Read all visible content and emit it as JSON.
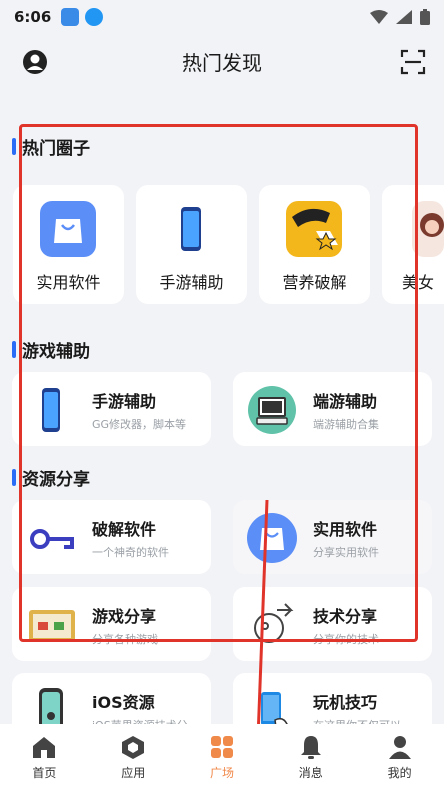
{
  "status_bar": {
    "time": "6:06"
  },
  "header": {
    "title": "热门发现"
  },
  "sections": {
    "hot_circles": {
      "title": "热门圈子"
    },
    "game_assist": {
      "title": "游戏辅助"
    },
    "resource_share": {
      "title": "资源分享"
    }
  },
  "hot_circles": [
    {
      "label": "实用软件",
      "icon": "bag-icon"
    },
    {
      "label": "手游辅助",
      "icon": "phone-icon"
    },
    {
      "label": "营养破解",
      "icon": "crack-icon"
    },
    {
      "label": "美女",
      "icon": "avatar-icon"
    }
  ],
  "game_assist": [
    {
      "title": "手游辅助",
      "subtitle": "GG修改器，脚本等",
      "icon": "phone-icon"
    },
    {
      "title": "端游辅助",
      "subtitle": "端游辅助合集",
      "icon": "pc-icon"
    }
  ],
  "resource_share": [
    {
      "title": "破解软件",
      "subtitle": "一个神奇的软件",
      "icon": "key-icon"
    },
    {
      "title": "实用软件",
      "subtitle": "分享实用软件",
      "icon": "bag-icon"
    },
    {
      "title": "游戏分享",
      "subtitle": "分享各种游戏",
      "icon": "game-icon"
    },
    {
      "title": "技术分享",
      "subtitle": "分享你的技术",
      "icon": "tech-icon"
    },
    {
      "title": "iOS资源",
      "subtitle": "iOS苹果资源技术分",
      "icon": "iphone-icon"
    },
    {
      "title": "玩机技巧",
      "subtitle": "在这里你不仅可以",
      "icon": "hand-phone-icon"
    }
  ],
  "tabs": [
    {
      "label": "首页",
      "icon": "home-icon"
    },
    {
      "label": "应用",
      "icon": "cube-icon"
    },
    {
      "label": "广场",
      "icon": "grid-icon",
      "active": true
    },
    {
      "label": "消息",
      "icon": "bell-icon"
    },
    {
      "label": "我的",
      "icon": "person-icon"
    }
  ],
  "colors": {
    "accent": "#2b6cf6",
    "active_tab": "#f08a4b",
    "annotation": "#e0342b"
  }
}
